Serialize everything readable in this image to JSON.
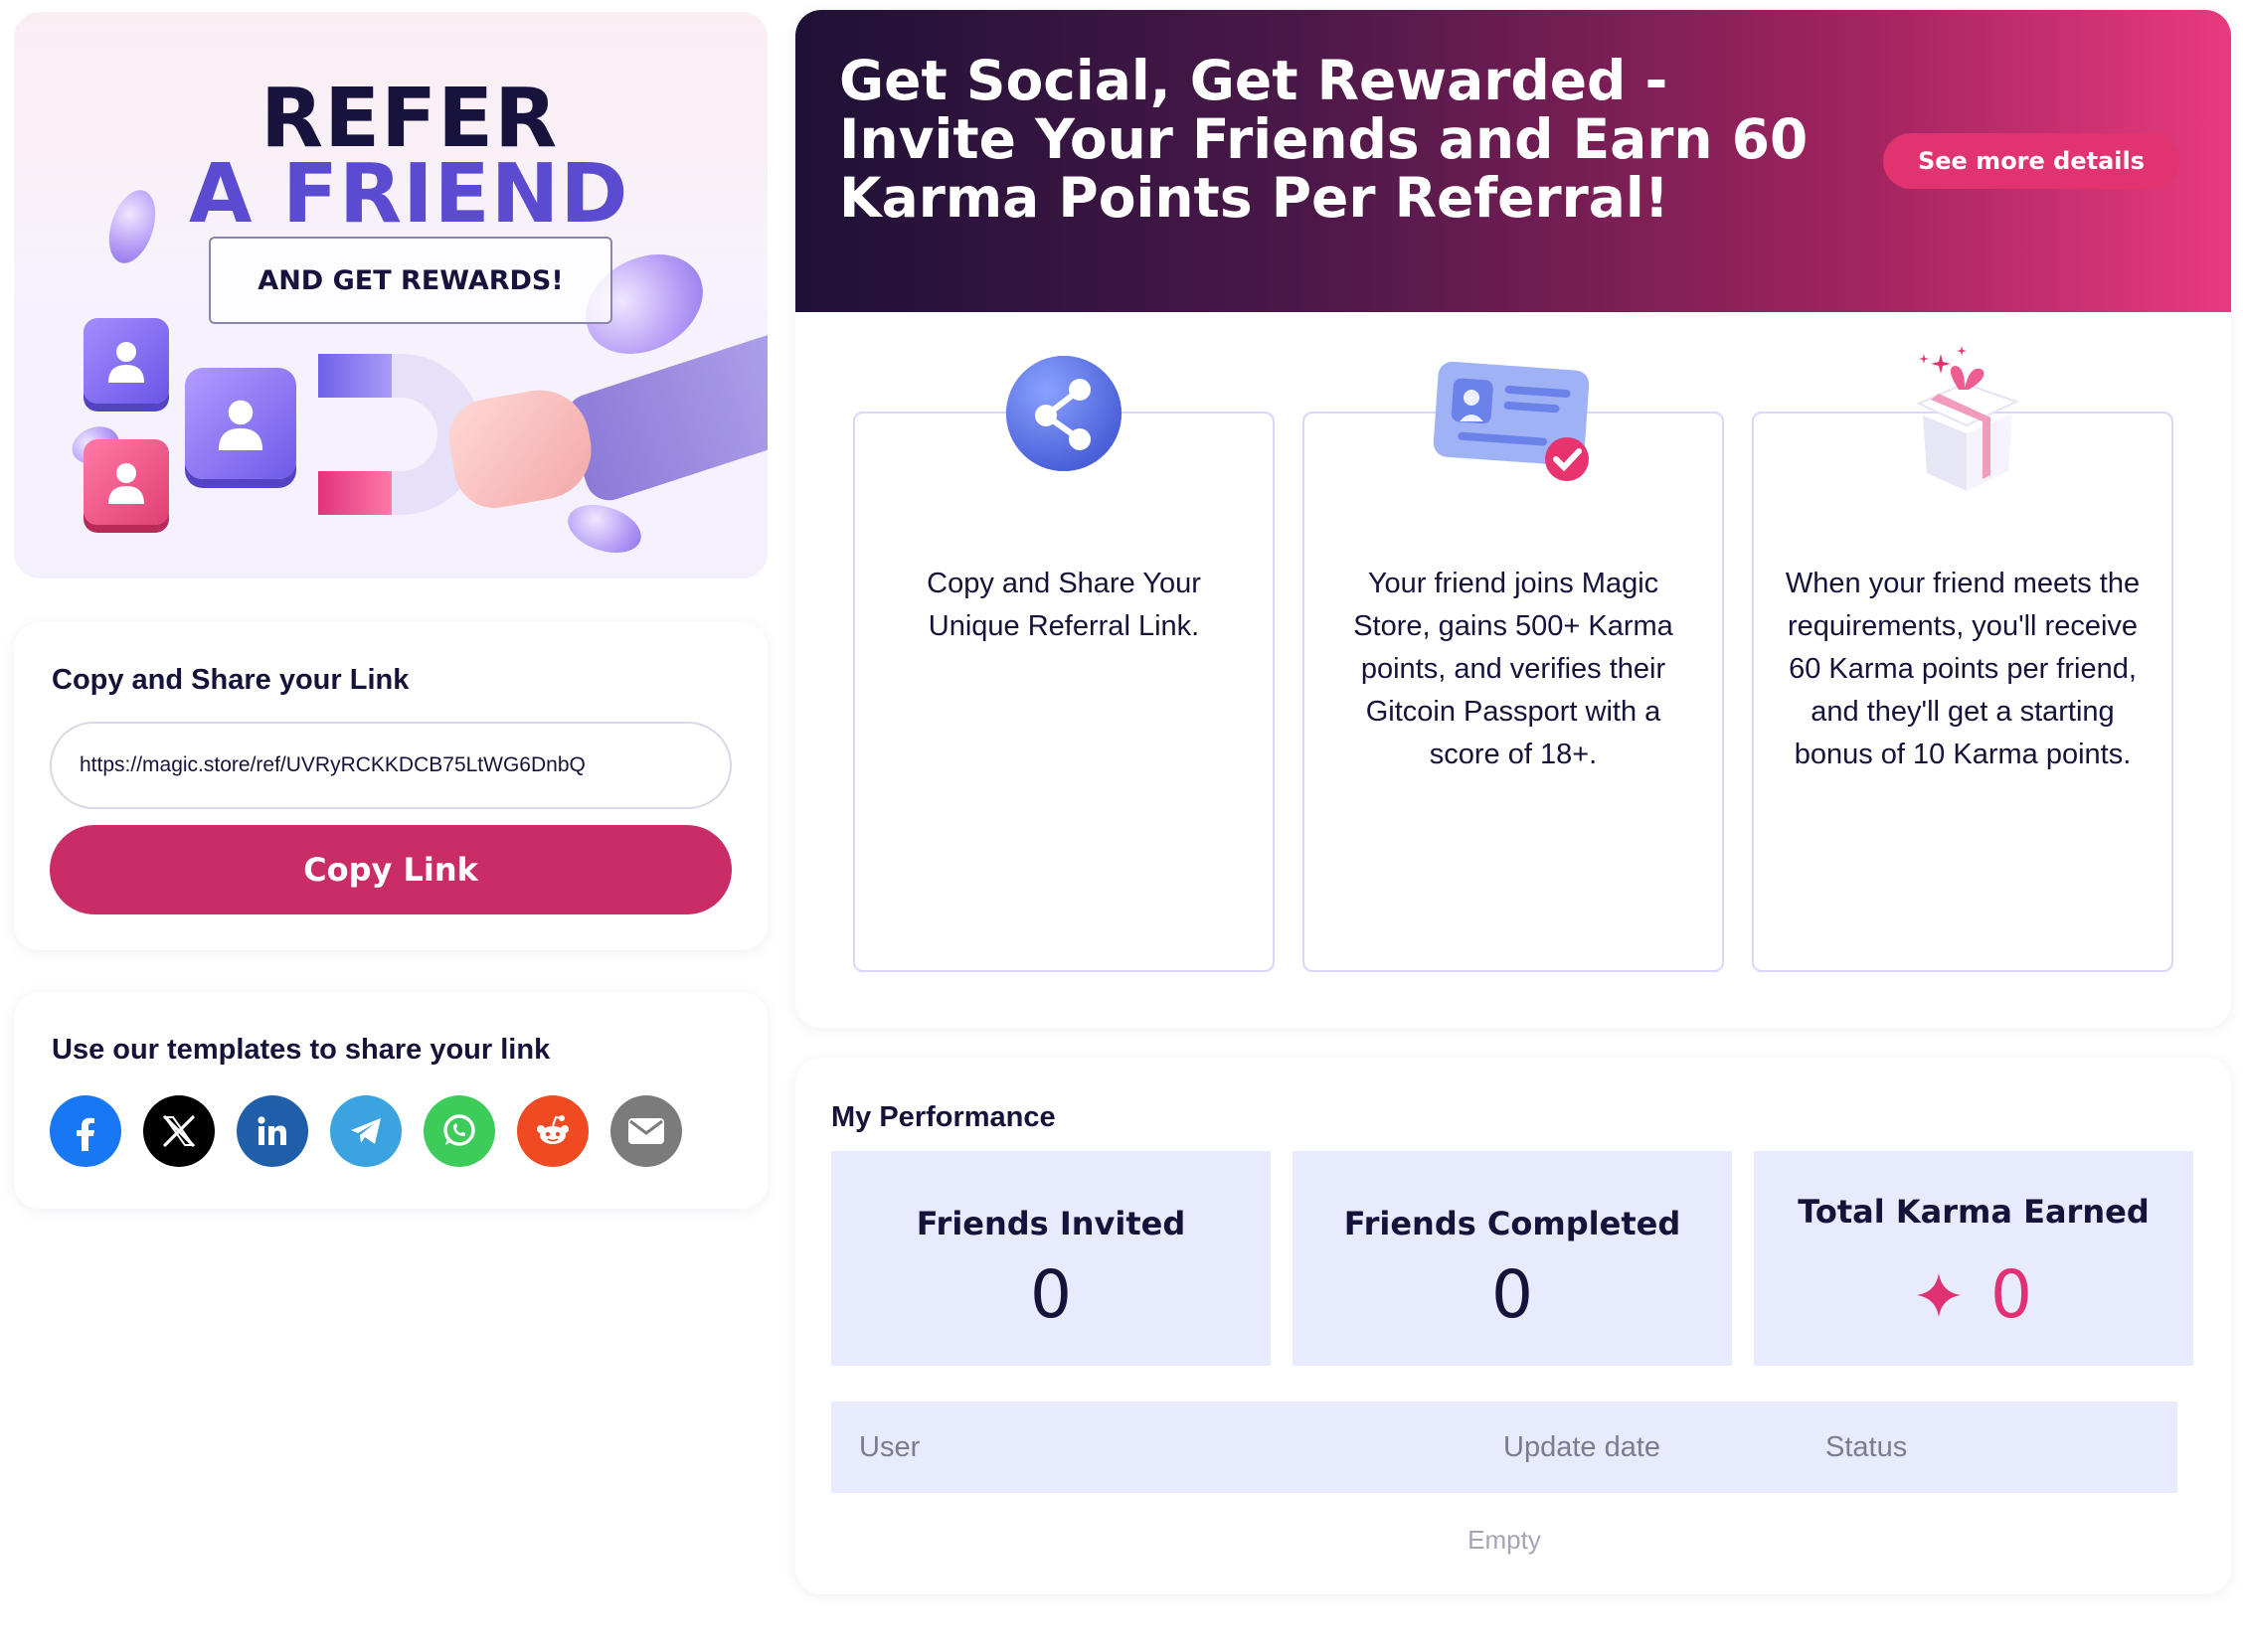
{
  "hero": {
    "line1": "REFER",
    "line2": "A FRIEND",
    "sub": "AND GET REWARDS!"
  },
  "link_card": {
    "heading": "Copy and Share your Link",
    "url": "https://magic.store/ref/UVRyRCKKDCB75LtWG6DnbQ",
    "copy_button": "Copy Link"
  },
  "share_card": {
    "heading": "Use our templates to share your link",
    "networks": [
      "facebook",
      "x",
      "linkedin",
      "telegram",
      "whatsapp",
      "reddit",
      "email"
    ]
  },
  "banner": {
    "title": "Get Social, Get Rewarded - Invite Your Friends and Earn 60 Karma Points Per Referral!",
    "details_button": "See more details"
  },
  "steps": [
    {
      "icon": "share-icon",
      "text": "Copy and Share Your Unique Referral Link."
    },
    {
      "icon": "id-card-icon",
      "text": "Your friend joins Magic Store, gains 500+ Karma points, and verifies their Gitcoin Passport with a score of 18+."
    },
    {
      "icon": "gift-icon",
      "text": "When your friend meets the requirements, you'll receive 60 Karma points per friend, and they'll get a starting bonus of 10 Karma points."
    }
  ],
  "performance": {
    "title": "My Performance",
    "stats": [
      {
        "label": "Friends Invited",
        "value": "0"
      },
      {
        "label": "Friends Completed",
        "value": "0"
      },
      {
        "label": "Total Karma Earned",
        "value": "0"
      }
    ],
    "table": {
      "columns": [
        "User",
        "Update date",
        "Status"
      ],
      "empty_text": "Empty"
    }
  },
  "colors": {
    "accent": "#c92c66",
    "banner_start": "#1e1136",
    "banner_end": "#e83a7e",
    "stat_bg": "#e8eafd",
    "karma": "#e03272"
  }
}
